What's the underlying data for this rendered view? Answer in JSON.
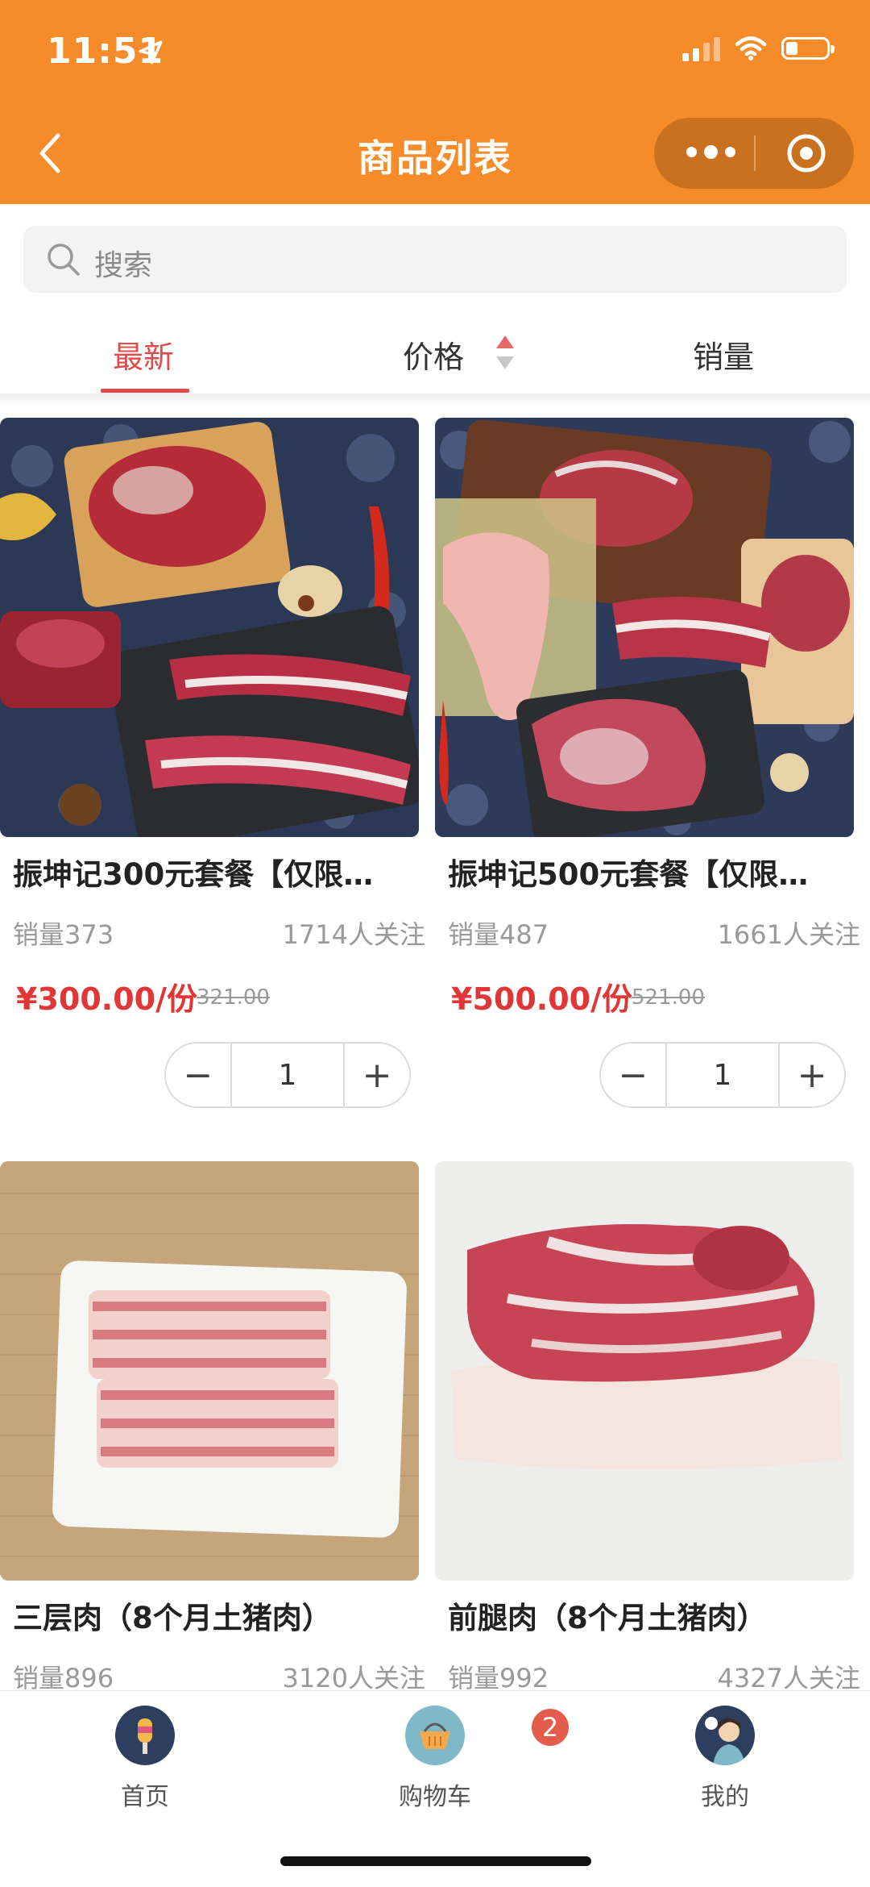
{
  "status_bar": {
    "time": "11:51"
  },
  "header": {
    "title": "商品列表"
  },
  "search": {
    "placeholder": "搜索"
  },
  "tabs": {
    "newest": "最新",
    "price": "价格",
    "sales": "销量"
  },
  "products": [
    {
      "name": "振坤记300元套餐【仅限…",
      "sales": "销量373",
      "followers": "1714人关注",
      "price": "¥300.00/份",
      "original_price": "321.00",
      "quantity": "1"
    },
    {
      "name": "振坤记500元套餐【仅限…",
      "sales": "销量487",
      "followers": "1661人关注",
      "price": "¥500.00/份",
      "original_price": "521.00",
      "quantity": "1"
    },
    {
      "name": "三层肉（8个月土猪肉）",
      "sales": "销量896",
      "followers": "3120人关注"
    },
    {
      "name": "前腿肉（8个月土猪肉）",
      "sales": "销量992",
      "followers": "4327人关注"
    }
  ],
  "stepper": {
    "minus": "−",
    "plus": "+"
  },
  "tabbar": {
    "home": "首页",
    "cart": "购物车",
    "cart_badge": "2",
    "mine": "我的"
  },
  "colors": {
    "brand": "#F68B2A",
    "accent_red": "#E04A4A",
    "price_red": "#E03636"
  }
}
